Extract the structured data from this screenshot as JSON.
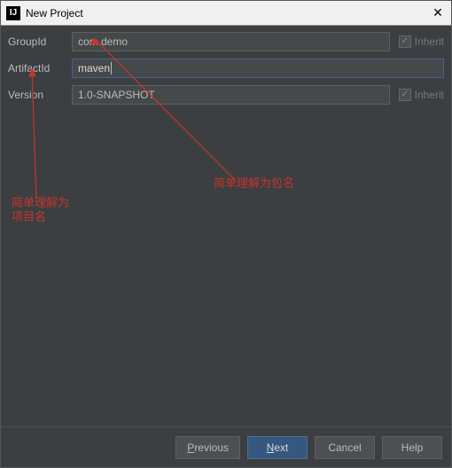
{
  "window": {
    "title": "New Project",
    "icon_text": "IJ"
  },
  "fields": {
    "groupId": {
      "label": "GroupId",
      "value": "com.demo",
      "inherit_label": "Inherit",
      "inherit_checked": true
    },
    "artifactId": {
      "label": "ArtifactId",
      "value": "maven"
    },
    "version": {
      "label": "Version",
      "value": "1.0-SNAPSHOT",
      "inherit_label": "Inherit",
      "inherit_checked": true
    }
  },
  "annotations": {
    "package_note": "简单理解为包名",
    "project_note_line1": "简单理解为",
    "project_note_line2": "项目名"
  },
  "buttons": {
    "previous": "Previous",
    "next": "Next",
    "cancel": "Cancel",
    "help": "Help"
  }
}
